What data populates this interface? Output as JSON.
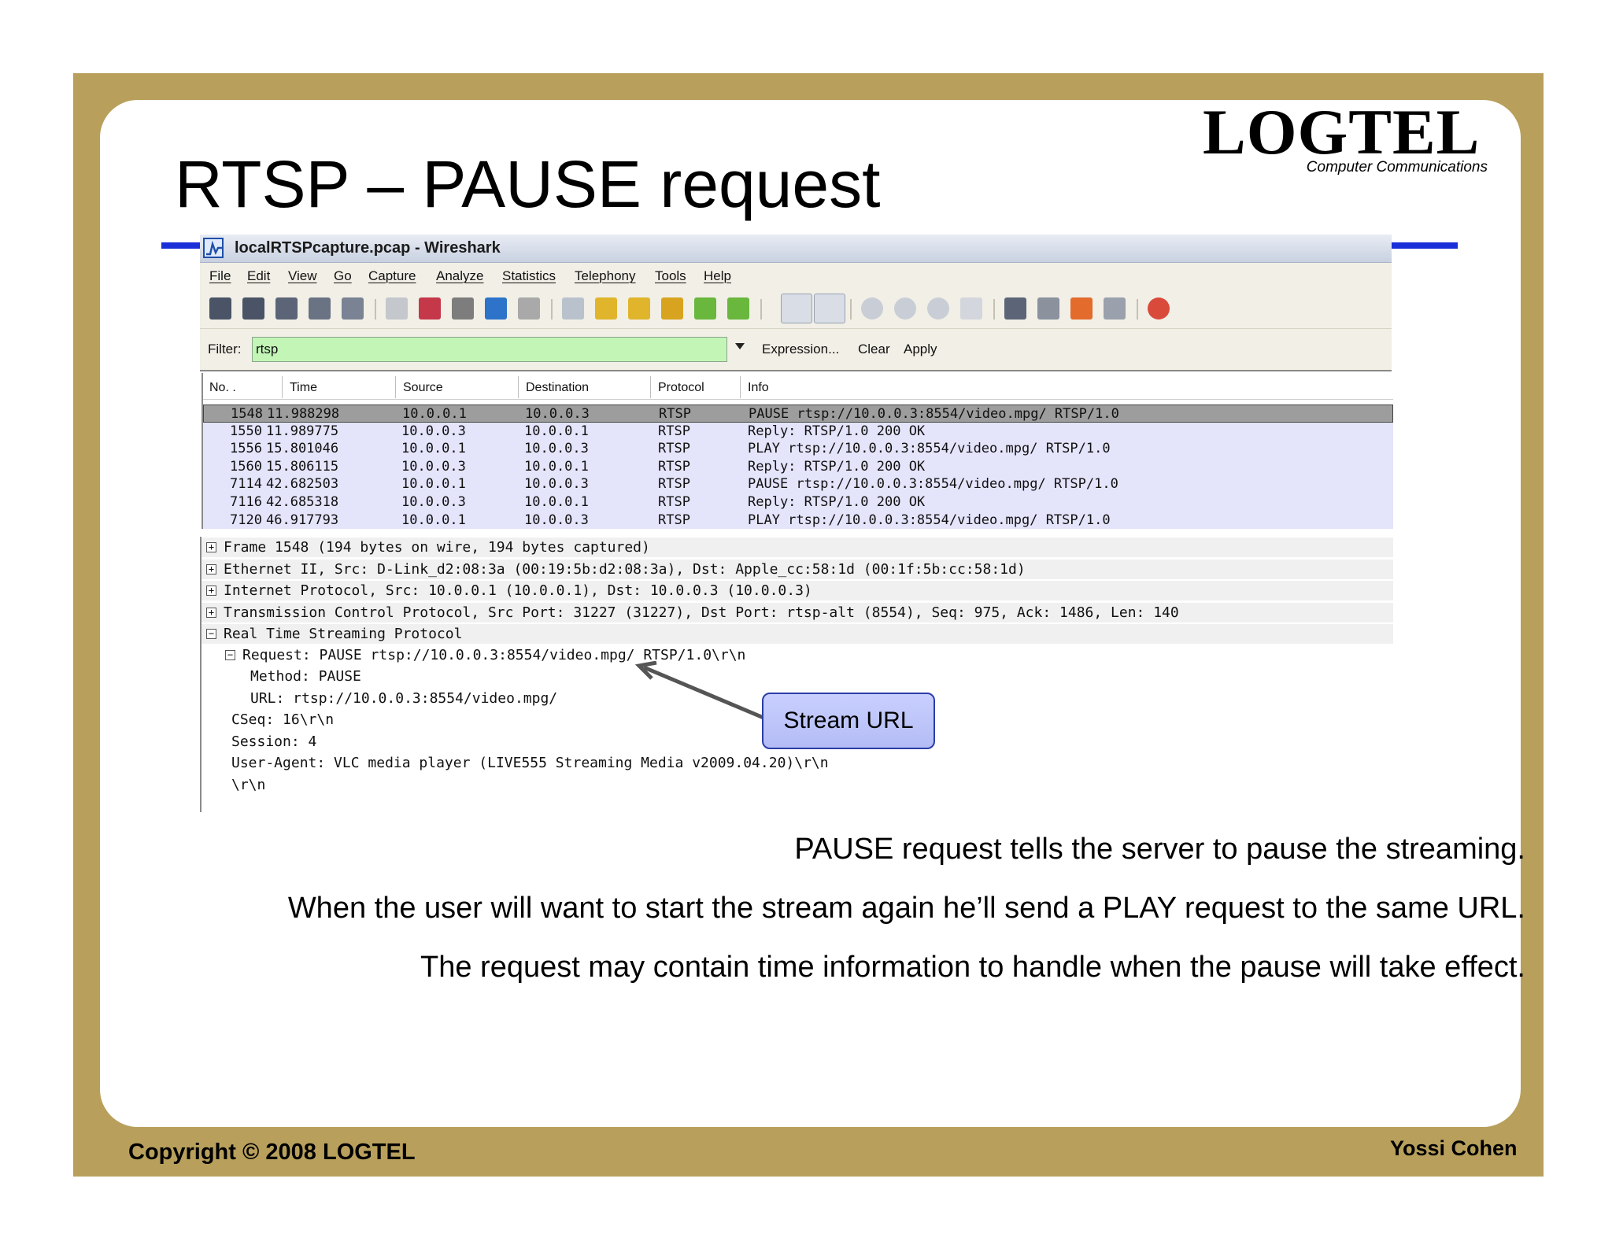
{
  "slide": {
    "title": "RTSP – PAUSE request",
    "logo_word": "LOGTEL",
    "logo_sub": "Computer Communications",
    "footer_left": "Copyright © 2008 LOGTEL",
    "footer_right": "Yossi Cohen",
    "captions": [
      "PAUSE request tells the server to pause the streaming.",
      "When the user will want to start the stream again he’ll send a PLAY request to the same URL.",
      "The request may contain time information to handle when the pause will take effect."
    ],
    "callout": "Stream URL"
  },
  "window": {
    "title": "localRTSPcapture.pcap - Wireshark",
    "menu": [
      "File",
      "Edit",
      "View",
      "Go",
      "Capture",
      "Analyze",
      "Statistics",
      "Telephony",
      "Tools",
      "Help"
    ],
    "toolbar_icons": [
      "interfaces-icon",
      "options-icon",
      "start-icon",
      "stop-icon",
      "restart-icon",
      "open-icon",
      "save-icon",
      "close-icon",
      "reload-icon",
      "print-icon",
      "find-icon",
      "back-icon",
      "forward-icon",
      "goto-icon",
      "top-icon",
      "bottom-icon",
      "colorize-icon",
      "autoscroll-icon",
      "zoom-in-icon",
      "zoom-out-icon",
      "zoom-normal-icon",
      "resize-columns-icon",
      "capture-filters-icon",
      "display-filters-icon",
      "coloring-rules-icon",
      "preferences-icon",
      "help-icon"
    ]
  },
  "filter": {
    "label": "Filter:",
    "value": "rtsp",
    "expression_label": "Expression...",
    "clear_label": "Clear",
    "apply_label": "Apply"
  },
  "packet_list": {
    "columns": [
      "No. .",
      "Time",
      "Source",
      "Destination",
      "Protocol",
      "Info"
    ],
    "rows": [
      {
        "no": "1548",
        "time": "11.988298",
        "src": "10.0.0.1",
        "dst": "10.0.0.3",
        "proto": "RTSP",
        "info": "PAUSE rtsp://10.0.0.3:8554/video.mpg/ RTSP/1.0",
        "selected": true
      },
      {
        "no": "1550",
        "time": "11.989775",
        "src": "10.0.0.3",
        "dst": "10.0.0.1",
        "proto": "RTSP",
        "info": "Reply: RTSP/1.0 200 OK",
        "selected": false
      },
      {
        "no": "1556",
        "time": "15.801046",
        "src": "10.0.0.1",
        "dst": "10.0.0.3",
        "proto": "RTSP",
        "info": "PLAY rtsp://10.0.0.3:8554/video.mpg/ RTSP/1.0",
        "selected": false
      },
      {
        "no": "1560",
        "time": "15.806115",
        "src": "10.0.0.3",
        "dst": "10.0.0.1",
        "proto": "RTSP",
        "info": "Reply: RTSP/1.0 200 OK",
        "selected": false
      },
      {
        "no": "7114",
        "time": "42.682503",
        "src": "10.0.0.1",
        "dst": "10.0.0.3",
        "proto": "RTSP",
        "info": "PAUSE rtsp://10.0.0.3:8554/video.mpg/ RTSP/1.0",
        "selected": false
      },
      {
        "no": "7116",
        "time": "42.685318",
        "src": "10.0.0.3",
        "dst": "10.0.0.1",
        "proto": "RTSP",
        "info": "Reply: RTSP/1.0 200 OK",
        "selected": false
      },
      {
        "no": "7120",
        "time": "46.917793",
        "src": "10.0.0.1",
        "dst": "10.0.0.3",
        "proto": "RTSP",
        "info": "PLAY rtsp://10.0.0.3:8554/video.mpg/ RTSP/1.0",
        "selected": false
      }
    ]
  },
  "details": {
    "lines": [
      {
        "text": "Frame 1548 (194 bytes on wire, 194 bytes captured)",
        "expander": "+",
        "indent": 0,
        "bar": true
      },
      {
        "text": "Ethernet II, Src: D-Link_d2:08:3a (00:19:5b:d2:08:3a), Dst: Apple_cc:58:1d (00:1f:5b:cc:58:1d)",
        "expander": "+",
        "indent": 0,
        "bar": true
      },
      {
        "text": "Internet Protocol, Src: 10.0.0.1 (10.0.0.1), Dst: 10.0.0.3 (10.0.0.3)",
        "expander": "+",
        "indent": 0,
        "bar": true
      },
      {
        "text": "Transmission Control Protocol, Src Port: 31227 (31227), Dst Port: rtsp-alt (8554), Seq: 975, Ack: 1486, Len: 140",
        "expander": "+",
        "indent": 0,
        "bar": true
      },
      {
        "text": "Real Time Streaming Protocol",
        "expander": "-",
        "indent": 0,
        "bar": true
      },
      {
        "text": "Request: PAUSE rtsp://10.0.0.3:8554/video.mpg/ RTSP/1.0\\r\\n",
        "expander": "-",
        "indent": 1,
        "bar": false
      },
      {
        "text": "Method: PAUSE",
        "expander": "",
        "indent": 2,
        "bar": false
      },
      {
        "text": "URL: rtsp://10.0.0.3:8554/video.mpg/",
        "expander": "",
        "indent": 2,
        "bar": false
      },
      {
        "text": "CSeq: 16\\r\\n",
        "expander": "",
        "indent": 1,
        "bar": false
      },
      {
        "text": "Session: 4",
        "expander": "",
        "indent": 1,
        "bar": false
      },
      {
        "text": "User-Agent: VLC media player (LIVE555 Streaming Media v2009.04.20)\\r\\n",
        "expander": "",
        "indent": 1,
        "bar": false
      },
      {
        "text": "\\r\\n",
        "expander": "",
        "indent": 1,
        "bar": false
      }
    ]
  },
  "colors": {
    "frame": "#b8a05c",
    "title_rule": "#1a2fd8",
    "filter_ok": "#c3f5b7",
    "row_bg": "#e4e4fb",
    "row_selected": "#9d9d9d",
    "callout_bg": "#c0c8fb",
    "callout_border": "#2b3da6"
  }
}
